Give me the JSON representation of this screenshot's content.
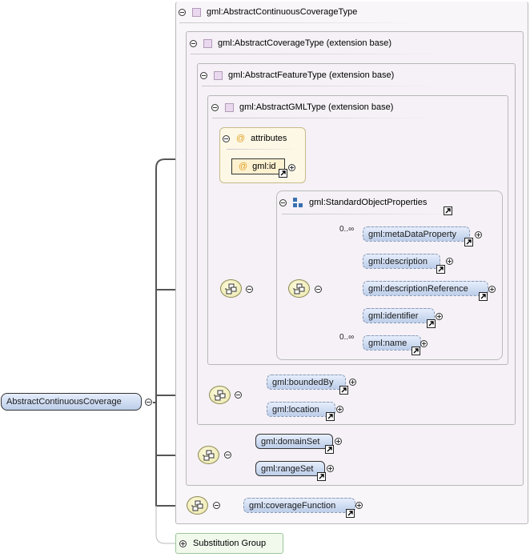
{
  "outer": {
    "title": "gml:AbstractContinuousCoverageType"
  },
  "coverage": {
    "title": "gml:AbstractCoverageType (extension base)"
  },
  "feature": {
    "title": "gml:AbstractFeatureType (extension base)"
  },
  "gml": {
    "title": "gml:AbstractGMLType (extension base)"
  },
  "attributes": {
    "title": "attributes",
    "at_symbol": "@",
    "items": [
      {
        "label": "gml:id"
      }
    ]
  },
  "standard": {
    "title": "gml:StandardObjectProperties",
    "occurrences": {
      "first": "0..∞",
      "last": "0..∞"
    },
    "items": [
      {
        "label": "gml:metaDataProperty"
      },
      {
        "label": "gml:description"
      },
      {
        "label": "gml:descriptionReference"
      },
      {
        "label": "gml:identifier"
      },
      {
        "label": "gml:name"
      }
    ]
  },
  "coverage_elements": [
    {
      "label": "gml:boundedBy"
    },
    {
      "label": "gml:location"
    }
  ],
  "continuous_elements": [
    {
      "label": "gml:domainSet"
    },
    {
      "label": "gml:rangeSet"
    }
  ],
  "function_element": {
    "label": "gml:coverageFunction"
  },
  "root": {
    "label": "AbstractContinuousCoverage"
  },
  "substitution": {
    "label": "Substitution Group"
  },
  "colors": {
    "element_fill": "#c9d8f2",
    "attribute_fill": "#fdf8e6",
    "sequence_fill": "#f3f0c4",
    "type_icon": "#ead9ee"
  },
  "icons": {
    "collapse": "minus-circle-icon",
    "expand": "plus-circle-icon",
    "sequence": "sequence-compositor-icon",
    "reference": "reference-arrow-icon",
    "type": "complex-type-icon",
    "group": "group-icon",
    "attribute": "at-sign-icon"
  }
}
